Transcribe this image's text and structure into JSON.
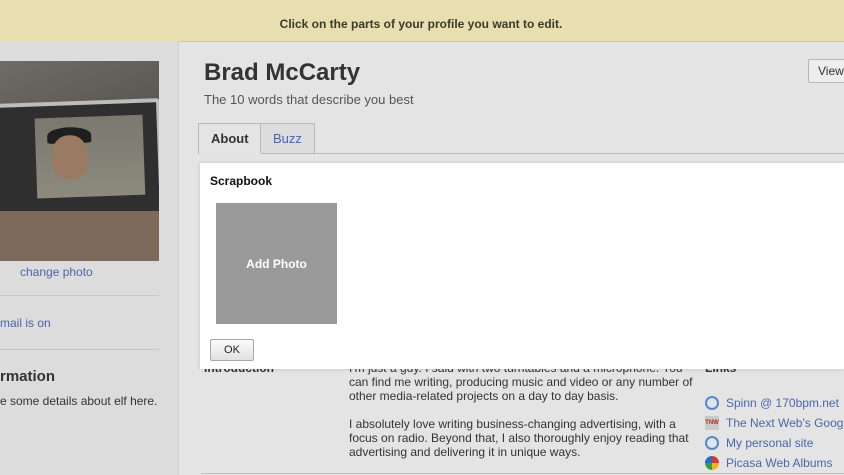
{
  "notice": {
    "text": "Click on the parts of your profile you want to edit."
  },
  "sidebar": {
    "change_photo": "change photo",
    "email_link": "mail is on",
    "section_heading": "rmation",
    "section_text": "e some details about elf here."
  },
  "profile": {
    "name": "Brad McCarty",
    "tagline": "The 10 words that describe you best",
    "view_button": "View"
  },
  "tabs": [
    {
      "label": "About",
      "active": true
    },
    {
      "label": "Buzz",
      "active": false
    }
  ],
  "about": {
    "intro_label": "Introduction",
    "intro_paragraphs": [
      "I'm just a guy. I said with two turntables and a microphone. You can find me writing, producing music and video or any number of other media-related projects on a day to day basis.",
      "I absolutely love writing business-changing advertising, with a focus on radio. Beyond that, I also thoroughly enjoy reading that advertising and delivering it in unique ways."
    ]
  },
  "links": {
    "heading": "Links",
    "items": [
      {
        "label": "Spinn @ 170bpm.net",
        "icon": "globe-icon"
      },
      {
        "label": "The Next Web's Goog",
        "icon": "tnw-icon"
      },
      {
        "label": "My personal site",
        "icon": "globe-icon"
      },
      {
        "label": "Picasa Web Albums",
        "icon": "picasa-icon"
      }
    ]
  },
  "modal": {
    "title": "Scrapbook",
    "add_photo": "Add Photo",
    "ok": "OK"
  },
  "colors": {
    "notice_bg": "#e8dfb0",
    "link": "#4a67a8",
    "tile": "#9a9a9a"
  }
}
